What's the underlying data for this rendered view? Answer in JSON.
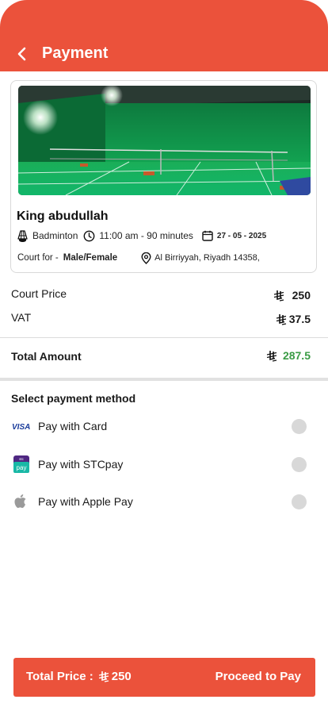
{
  "header": {
    "title": "Payment"
  },
  "venue": {
    "name": "King abudullah",
    "sport": "Badminton",
    "time": "11:00 am - 90 minutes",
    "date": "27 - 05 - 2025",
    "court_for_label": "Court for -",
    "court_for_value": "Male/Female",
    "location": "Al Birriyyah, Riyadh 14358,"
  },
  "pricing": {
    "court_price_label": "Court Price",
    "court_price_value": "250",
    "vat_label": "VAT",
    "vat_value": "37.5",
    "total_label": "Total Amount",
    "total_value": "287.5"
  },
  "payment": {
    "section_title": "Select payment method",
    "methods": [
      {
        "label": "Pay with Card",
        "icon": "visa-icon"
      },
      {
        "label": "Pay with STCpay",
        "icon": "stcpay-icon"
      },
      {
        "label": "Pay with Apple Pay",
        "icon": "apple-icon"
      }
    ]
  },
  "footer": {
    "total_label": "Total Price :",
    "total_value": "250",
    "proceed_label": "Proceed to Pay"
  },
  "colors": {
    "accent": "#eb523b",
    "total_green": "#3a9b45",
    "radio_grey": "#d8d8d8"
  }
}
